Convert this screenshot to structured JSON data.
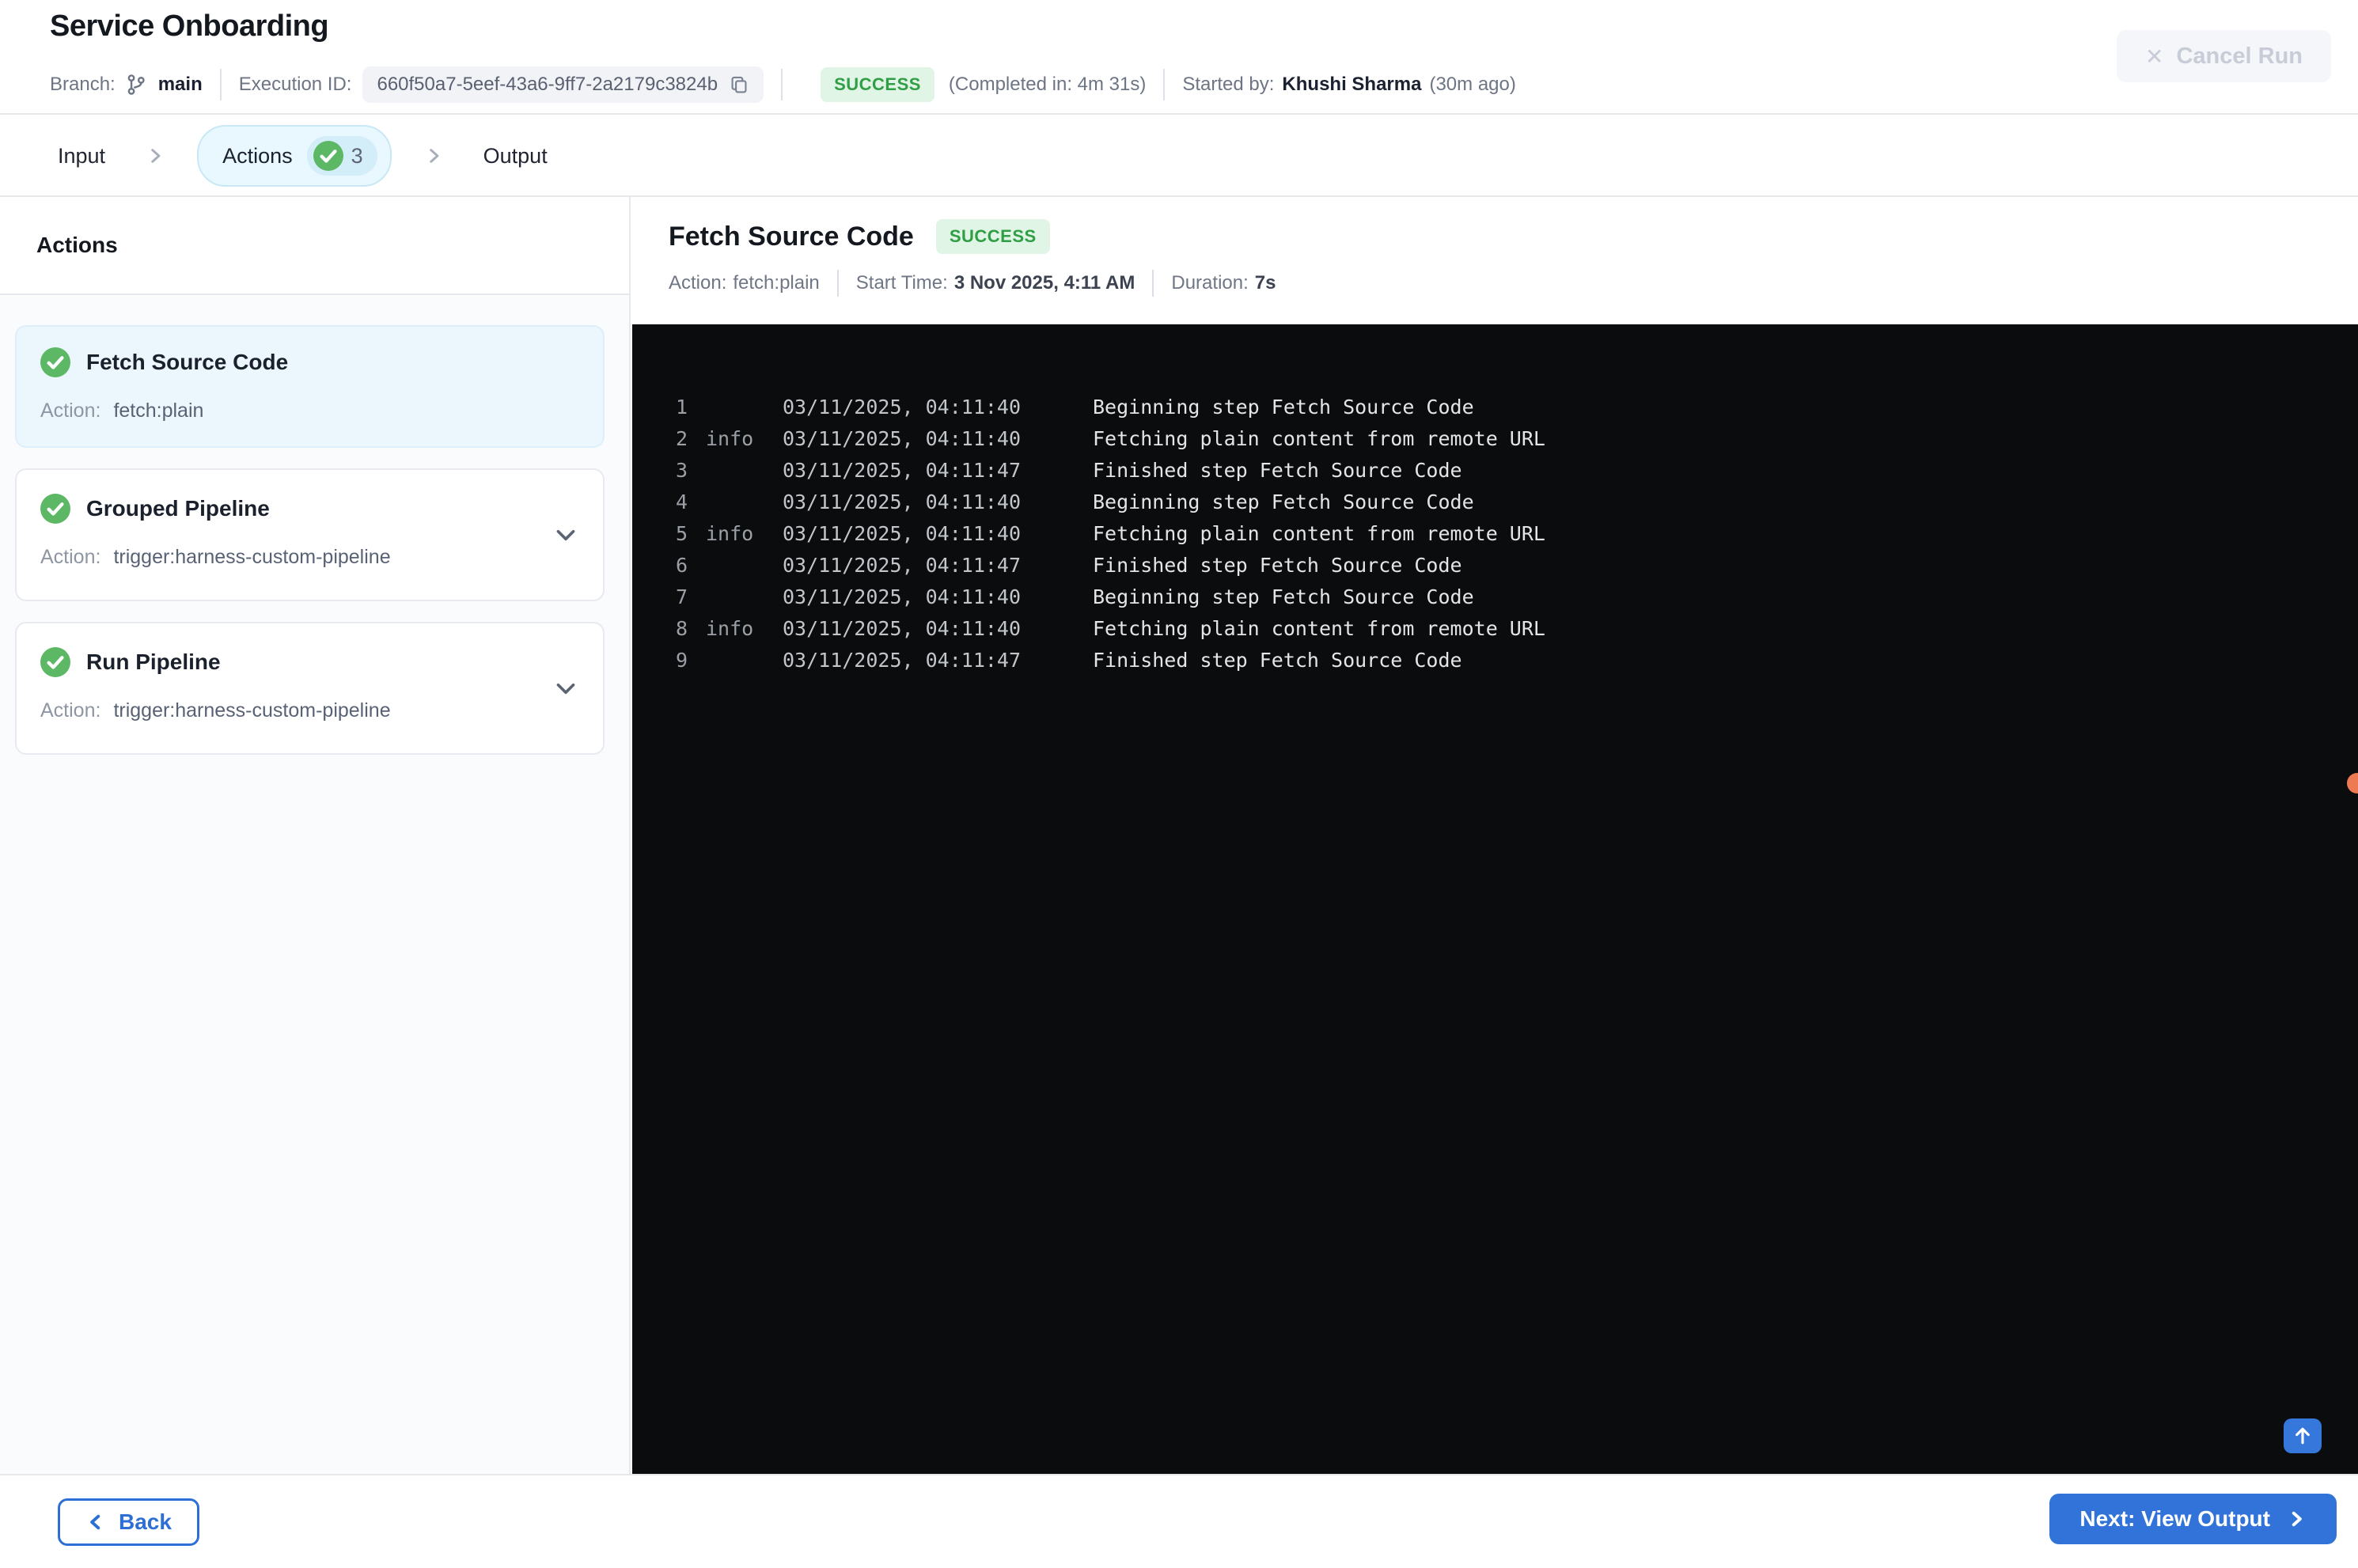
{
  "header": {
    "title": "Service Onboarding",
    "branch_label": "Branch:",
    "branch_name": "main",
    "execution_id_label": "Execution ID:",
    "execution_id": "660f50a7-5eef-43a6-9ff7-2a2179c3824b",
    "status": "SUCCESS",
    "completed_in": "(Completed in: 4m 31s)",
    "started_by_label": "Started by:",
    "started_by": "Khushi Sharma",
    "started_ago": "(30m ago)",
    "cancel_label": "Cancel Run",
    "cancel_icon": "✕"
  },
  "tabs": {
    "input": "Input",
    "actions": "Actions",
    "actions_count": "3",
    "output": "Output"
  },
  "sidebar": {
    "heading": "Actions",
    "items": [
      {
        "title": "Fetch Source Code",
        "action_label": "Action:",
        "action": "fetch:plain",
        "selected": true
      },
      {
        "title": "Grouped Pipeline",
        "action_label": "Action:",
        "action": "trigger:harness-custom-pipeline",
        "selected": false
      },
      {
        "title": "Run Pipeline",
        "action_label": "Action:",
        "action": "trigger:harness-custom-pipeline",
        "selected": false
      }
    ]
  },
  "detail": {
    "title": "Fetch Source Code",
    "status": "SUCCESS",
    "action_label": "Action:",
    "action_value": "fetch:plain",
    "start_label": "Start Time:",
    "start_value": "3 Nov 2025, 4:11 AM",
    "duration_label": "Duration:",
    "duration_value": "7s"
  },
  "console": {
    "lines": [
      {
        "num": "1",
        "tag": "",
        "time": "03/11/2025, 04:11:40",
        "msg": "Beginning step Fetch Source Code"
      },
      {
        "num": "2",
        "tag": "info",
        "time": "03/11/2025, 04:11:40",
        "msg": "Fetching plain content from remote URL"
      },
      {
        "num": "3",
        "tag": "",
        "time": "03/11/2025, 04:11:47",
        "msg": "Finished step Fetch Source Code"
      },
      {
        "num": "4",
        "tag": "",
        "time": "03/11/2025, 04:11:40",
        "msg": "Beginning step Fetch Source Code"
      },
      {
        "num": "5",
        "tag": "info",
        "time": "03/11/2025, 04:11:40",
        "msg": "Fetching plain content from remote URL"
      },
      {
        "num": "6",
        "tag": "",
        "time": "03/11/2025, 04:11:47",
        "msg": "Finished step Fetch Source Code"
      },
      {
        "num": "7",
        "tag": "",
        "time": "03/11/2025, 04:11:40",
        "msg": "Beginning step Fetch Source Code"
      },
      {
        "num": "8",
        "tag": "info",
        "time": "03/11/2025, 04:11:40",
        "msg": "Fetching plain content from remote URL"
      },
      {
        "num": "9",
        "tag": "",
        "time": "03/11/2025, 04:11:47",
        "msg": "Finished step Fetch Source Code"
      }
    ]
  },
  "footer": {
    "back_label": "Back",
    "next_label": "Next: View Output"
  },
  "colors": {
    "accent_blue": "#3273d9",
    "success_green": "#5cb865",
    "success_badge_bg": "#e0f5e6",
    "success_badge_text": "#2f9e44",
    "selected_card_bg": "#ebf6fd",
    "tab_pill_bg": "#e9f7fe",
    "console_bg": "#0a0c0d",
    "orange_dot": "#ed7a52",
    "disabled_text": "#c7ccd7"
  }
}
